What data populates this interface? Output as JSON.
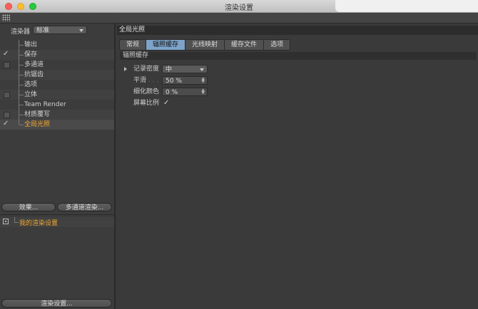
{
  "window": {
    "title": "渲染设置"
  },
  "sidebar": {
    "renderer_label": "渲染器",
    "renderer_value": "标准",
    "items": [
      {
        "label": "输出",
        "checkbox": "none",
        "active": false
      },
      {
        "label": "保存",
        "checkbox": "checked",
        "active": false
      },
      {
        "label": "多通道",
        "checkbox": "unchecked",
        "active": false
      },
      {
        "label": "抗锯齿",
        "checkbox": "none",
        "active": false
      },
      {
        "label": "选项",
        "checkbox": "none",
        "active": false
      },
      {
        "label": "立体",
        "checkbox": "unchecked",
        "active": false
      },
      {
        "label": "Team Render",
        "checkbox": "none",
        "active": false
      },
      {
        "label": "材质覆写",
        "checkbox": "unchecked",
        "active": false
      },
      {
        "label": "全局光照",
        "checkbox": "checked",
        "active": true
      }
    ],
    "effects_button": "效果...",
    "multipass_button": "多通道渲染...",
    "settings_item": "我的渲染设置",
    "render_settings_button": "渲染设置..."
  },
  "main": {
    "section_title": "全局光照",
    "tabs": [
      "常规",
      "辐照缓存",
      "光线映射",
      "缓存文件",
      "选项"
    ],
    "active_tab_index": 1,
    "group_title": "辐照缓存",
    "props": {
      "density_label": "记录密度",
      "density_value": "中",
      "smooth_label": "平滑",
      "smooth_dots": ". . .",
      "smooth_value": "50 %",
      "detail_label": "细化颜色",
      "detail_value": "0 %",
      "screen_label": "屏幕比例",
      "screen_checked": true
    }
  },
  "colors": {
    "active_text": "#f0a630",
    "active_tab": "#7da3c9"
  }
}
